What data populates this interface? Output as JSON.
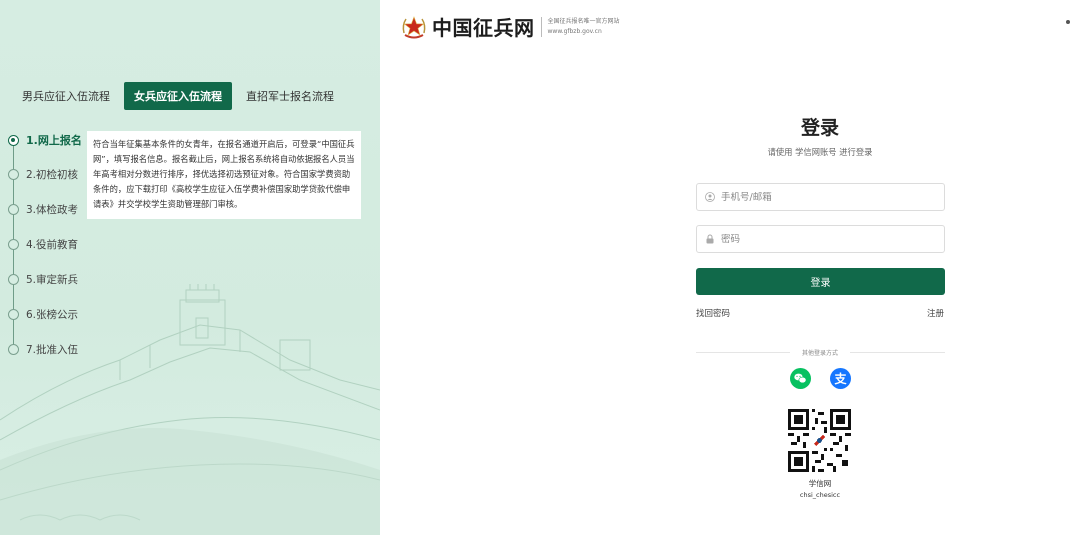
{
  "header": {
    "site_title": "中国征兵网",
    "site_subtitle": "全国征兵报名唯一官方网站",
    "site_url": "www.gfbzb.gov.cn",
    "emblem_icon": "army-star-emblem-icon"
  },
  "tabs": [
    {
      "label": "男兵应征入伍流程",
      "active": false
    },
    {
      "label": "女兵应征入伍流程",
      "active": true
    },
    {
      "label": "直招军士报名流程",
      "active": false
    }
  ],
  "steps": [
    {
      "label": "1.网上报名",
      "active": true
    },
    {
      "label": "2.初检初核",
      "active": false
    },
    {
      "label": "3.体检政考",
      "active": false
    },
    {
      "label": "4.役前教育",
      "active": false
    },
    {
      "label": "5.审定新兵",
      "active": false
    },
    {
      "label": "6.张榜公示",
      "active": false
    },
    {
      "label": "7.批准入伍",
      "active": false
    }
  ],
  "step_description": "符合当年征集基本条件的女青年，在报名通道开启后，可登录“中国征兵网”，填写报名信息。报名截止后，网上报名系统将自动依据报名人员当年高考相对分数进行排序，择优选择初选预征对象。符合国家学费资助条件的，应下载打印《高校学生应征入伍学费补偿国家助学贷款代偿申请表》并交学校学生资助管理部门审核。",
  "login": {
    "title": "登录",
    "subtitle": "请使用 学信网账号 进行登录",
    "username_placeholder": "手机号/邮箱",
    "password_placeholder": "密码",
    "submit_label": "登录",
    "forgot_label": "找回密码",
    "register_label": "注册",
    "other_methods_label": "其他登录方式",
    "social": [
      {
        "name": "wechat",
        "icon": "wechat-icon",
        "color": "#07c160"
      },
      {
        "name": "alipay",
        "icon": "alipay-icon",
        "color": "#1677ff"
      }
    ],
    "qr_name": "学信网",
    "qr_id": "chsi_chesicc"
  },
  "colors": {
    "primary": "#11694a",
    "left_panel_bg": "#d6ede2"
  }
}
